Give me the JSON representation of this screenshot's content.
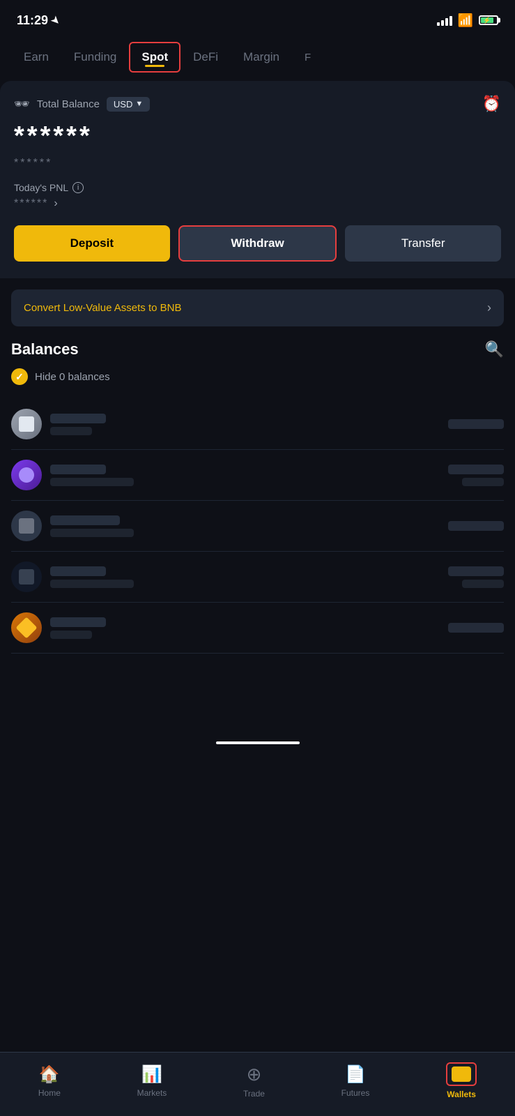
{
  "statusBar": {
    "time": "11:29",
    "locationArrow": "▲"
  },
  "navTabs": {
    "items": [
      {
        "id": "earn",
        "label": "Earn",
        "active": false
      },
      {
        "id": "funding",
        "label": "Funding",
        "active": false
      },
      {
        "id": "spot",
        "label": "Spot",
        "active": true
      },
      {
        "id": "defi",
        "label": "DeFi",
        "active": false
      },
      {
        "id": "margin",
        "label": "Margin",
        "active": false
      },
      {
        "id": "more",
        "label": "F",
        "active": false
      }
    ]
  },
  "balanceCard": {
    "labelText": "Total Balance",
    "currencyBadge": "USD",
    "mainBalance": "******",
    "subBalance": "******",
    "pnlLabel": "Today's PNL",
    "pnlValue": "******",
    "depositLabel": "Deposit",
    "withdrawLabel": "Withdraw",
    "transferLabel": "Transfer"
  },
  "convertBanner": {
    "text": "Convert Low-Value Assets to BNB",
    "arrow": "›"
  },
  "balancesSection": {
    "title": "Balances",
    "hideZeroLabel": "Hide 0 balances",
    "coins": [
      {
        "id": "coin1",
        "color": "#4a5568",
        "gradient": true
      },
      {
        "id": "coin2",
        "color": "#6d28d9",
        "gradient": true
      },
      {
        "id": "coin3",
        "color": "#374151",
        "gradient": false
      },
      {
        "id": "coin4",
        "color": "#111827",
        "gradient": false
      },
      {
        "id": "coin5",
        "color": "#92400e",
        "gradient": true
      }
    ]
  },
  "bottomNav": {
    "items": [
      {
        "id": "home",
        "label": "Home",
        "icon": "🏠",
        "active": false
      },
      {
        "id": "markets",
        "label": "Markets",
        "icon": "📊",
        "active": false
      },
      {
        "id": "trade",
        "label": "Trade",
        "icon": "⭕",
        "active": false
      },
      {
        "id": "futures",
        "label": "Futures",
        "icon": "📋",
        "active": false
      },
      {
        "id": "wallets",
        "label": "Wallets",
        "icon": "wallet",
        "active": true
      }
    ]
  }
}
